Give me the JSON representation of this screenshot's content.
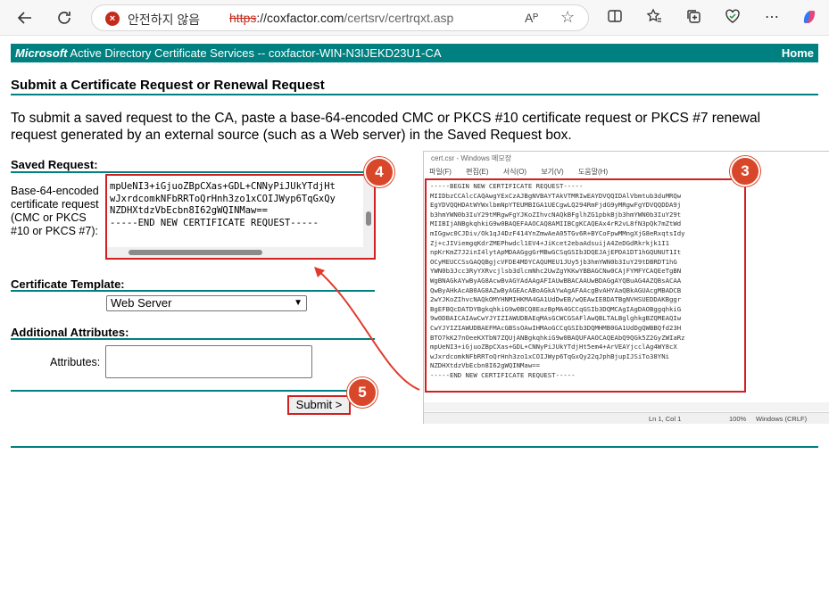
{
  "browser": {
    "security_label": "안전하지 않음",
    "url_scheme": "https",
    "url_host": "://coxfactor.com",
    "url_path": "/certsrv/certrqxt.asp",
    "read_aloud": "Aᴾ"
  },
  "banner": {
    "brand": "Microsoft",
    "product": " Active Directory Certificate Services  --  coxfactor-WIN-N3IJEKD23U1-CA",
    "home": "Home"
  },
  "page": {
    "title": "Submit a Certificate Request or Renewal Request",
    "intro": "To submit a saved request to the CA, paste a base-64-encoded CMC or PKCS #10 certificate request or PKCS #7 renewal request generated by an external source (such as a Web server) in the Saved Request box."
  },
  "saved_request": {
    "section": "Saved Request:",
    "label": "Base-64-encoded certificate request (CMC or PKCS #10 or PKCS #7):",
    "content": "mpUeNI3+iGjuoZBpCXas+GDL+CNNyPiJUkYTdjHt\nwJxrdcomkNFbRRToQrHnh3zo1xCOIJWyp6TqGxQy\nNZDHXtdzVbEcbn8I62gWQINMaw==\n-----END NEW CERTIFICATE REQUEST-----\n"
  },
  "template": {
    "section": "Certificate Template:",
    "selected": "Web Server"
  },
  "attributes": {
    "section": "Additional Attributes:",
    "label": "Attributes:"
  },
  "submit_label": "Submit >",
  "badges": {
    "b3": "3",
    "b4": "4",
    "b5": "5"
  },
  "notepad": {
    "title": "cert.csr - Windows 메모장",
    "menu": [
      "파일(F)",
      "편집(E)",
      "서식(O)",
      "보기(V)",
      "도움말(H)"
    ],
    "content": "-----BEGIN NEW CERTIFICATE REQUEST-----\nMIIDbzCCAlcCAQAwgYExCzAJBgNVBAYTAkVTMRIwEAYDVQQIDAlVbmtub3duMRQw\nEgYDVQQHDAtWYWxlbmNpYTEUMBIGA1UECgwLQ294RmFjdG9yMRgwFgYDVQQDDA9j\nb3hmYWN0b3IuY29tMRgwFgYJKoZIhvcNAQkBFglhZG1pbkBjb3hmYWN0b3IuY29t\nMIIBIjANBgkqhkiG9w0BAQEFAAOCAQ8AMIIBCgKCAQEAx4rR2vL8fN3pQk7mZtWd\nmIGgwc0CJDiv/Ok1qJ4DzF414YnZmwAeA05TGv6R+BYCoFpwMMngXjG8eRxqtsIdy\nZj+cJIViemgqKdrZMEPhwdcl1EV4+JiKcet2ebaAdsuijA4ZeDGdRkrkjk1I1\nnpKrKmZ7J2inI4lytApMDAAGggGrMBwGCSqGSIb3DQEJAjEPDA1DT1hGQUNUT1It\nOCyMEUCCSsGAQQBgjcVFDE4MDYCAQUMEU1JUy5jb3hmYWN0b3IuY29tDBRDT1hG\nYWN0b3Jcc3RyYXRvcjlsb3dlcmNhc2UwZgYKKwYBBAGCNw0CAjFYMFYCAQEeTgBN\nWgBNAGkAYwByAG8AcwBvAGYAdAAgAFIAUwBBACAAUwBDAGgAYQBuAG4AZQBsACAA\nQwByAHkAcAB0AG8AZwByAGEAcABoAGkAYwAgAFAAcgBvAHYAaQBkAGUAcgMBADCB\n2wYJKoZIhvcNAQkOMYHNMIHKMA4GA1UdDwEB/wQEAwIE8DATBgNVHSUEDDAKBggr\nBgEFBQcDATDYBgkqhkiG9w0BCQ8EazBpMA4GCCqGSIb3DQMCAgIAgDAOBggqhkiG\n9w0DBAICAIAwCwYJYIZIAWUDBAEqMAsGCWCGSAFlAwQBLTALBglghkgBZQMEAQIw\nCwYJYIZIAWUDBAEFMAcGBSsOAwIHMAoGCCqGSIb3DQMHMB0GA1UdDgQWBBQfd23H\nBTO7kK27nOeeKXTbN7ZQUjANBgkqhkiG9w0BAQUFAAOCAQEAbQ9QGk5Z2GyZWIaRz\nmpUeNI3+iGjuoZBpCXas+GDL+CNNyPiJUkYTdjHt5em4+ArVEAYjcclAg4WY8cX\nwJxrdcomkNFbRRToQrHnh3zo1xCOIJWyp6TqGxQy22qJphBjupIJSiTo38YNi\nNZDHXtdzVbEcbn8I62gWQINMaw==\n-----END NEW CERTIFICATE REQUEST-----",
    "status_pos": "Ln 1, Col 1",
    "status_zoom": "100%",
    "status_eol": "Windows (CRLF)"
  }
}
